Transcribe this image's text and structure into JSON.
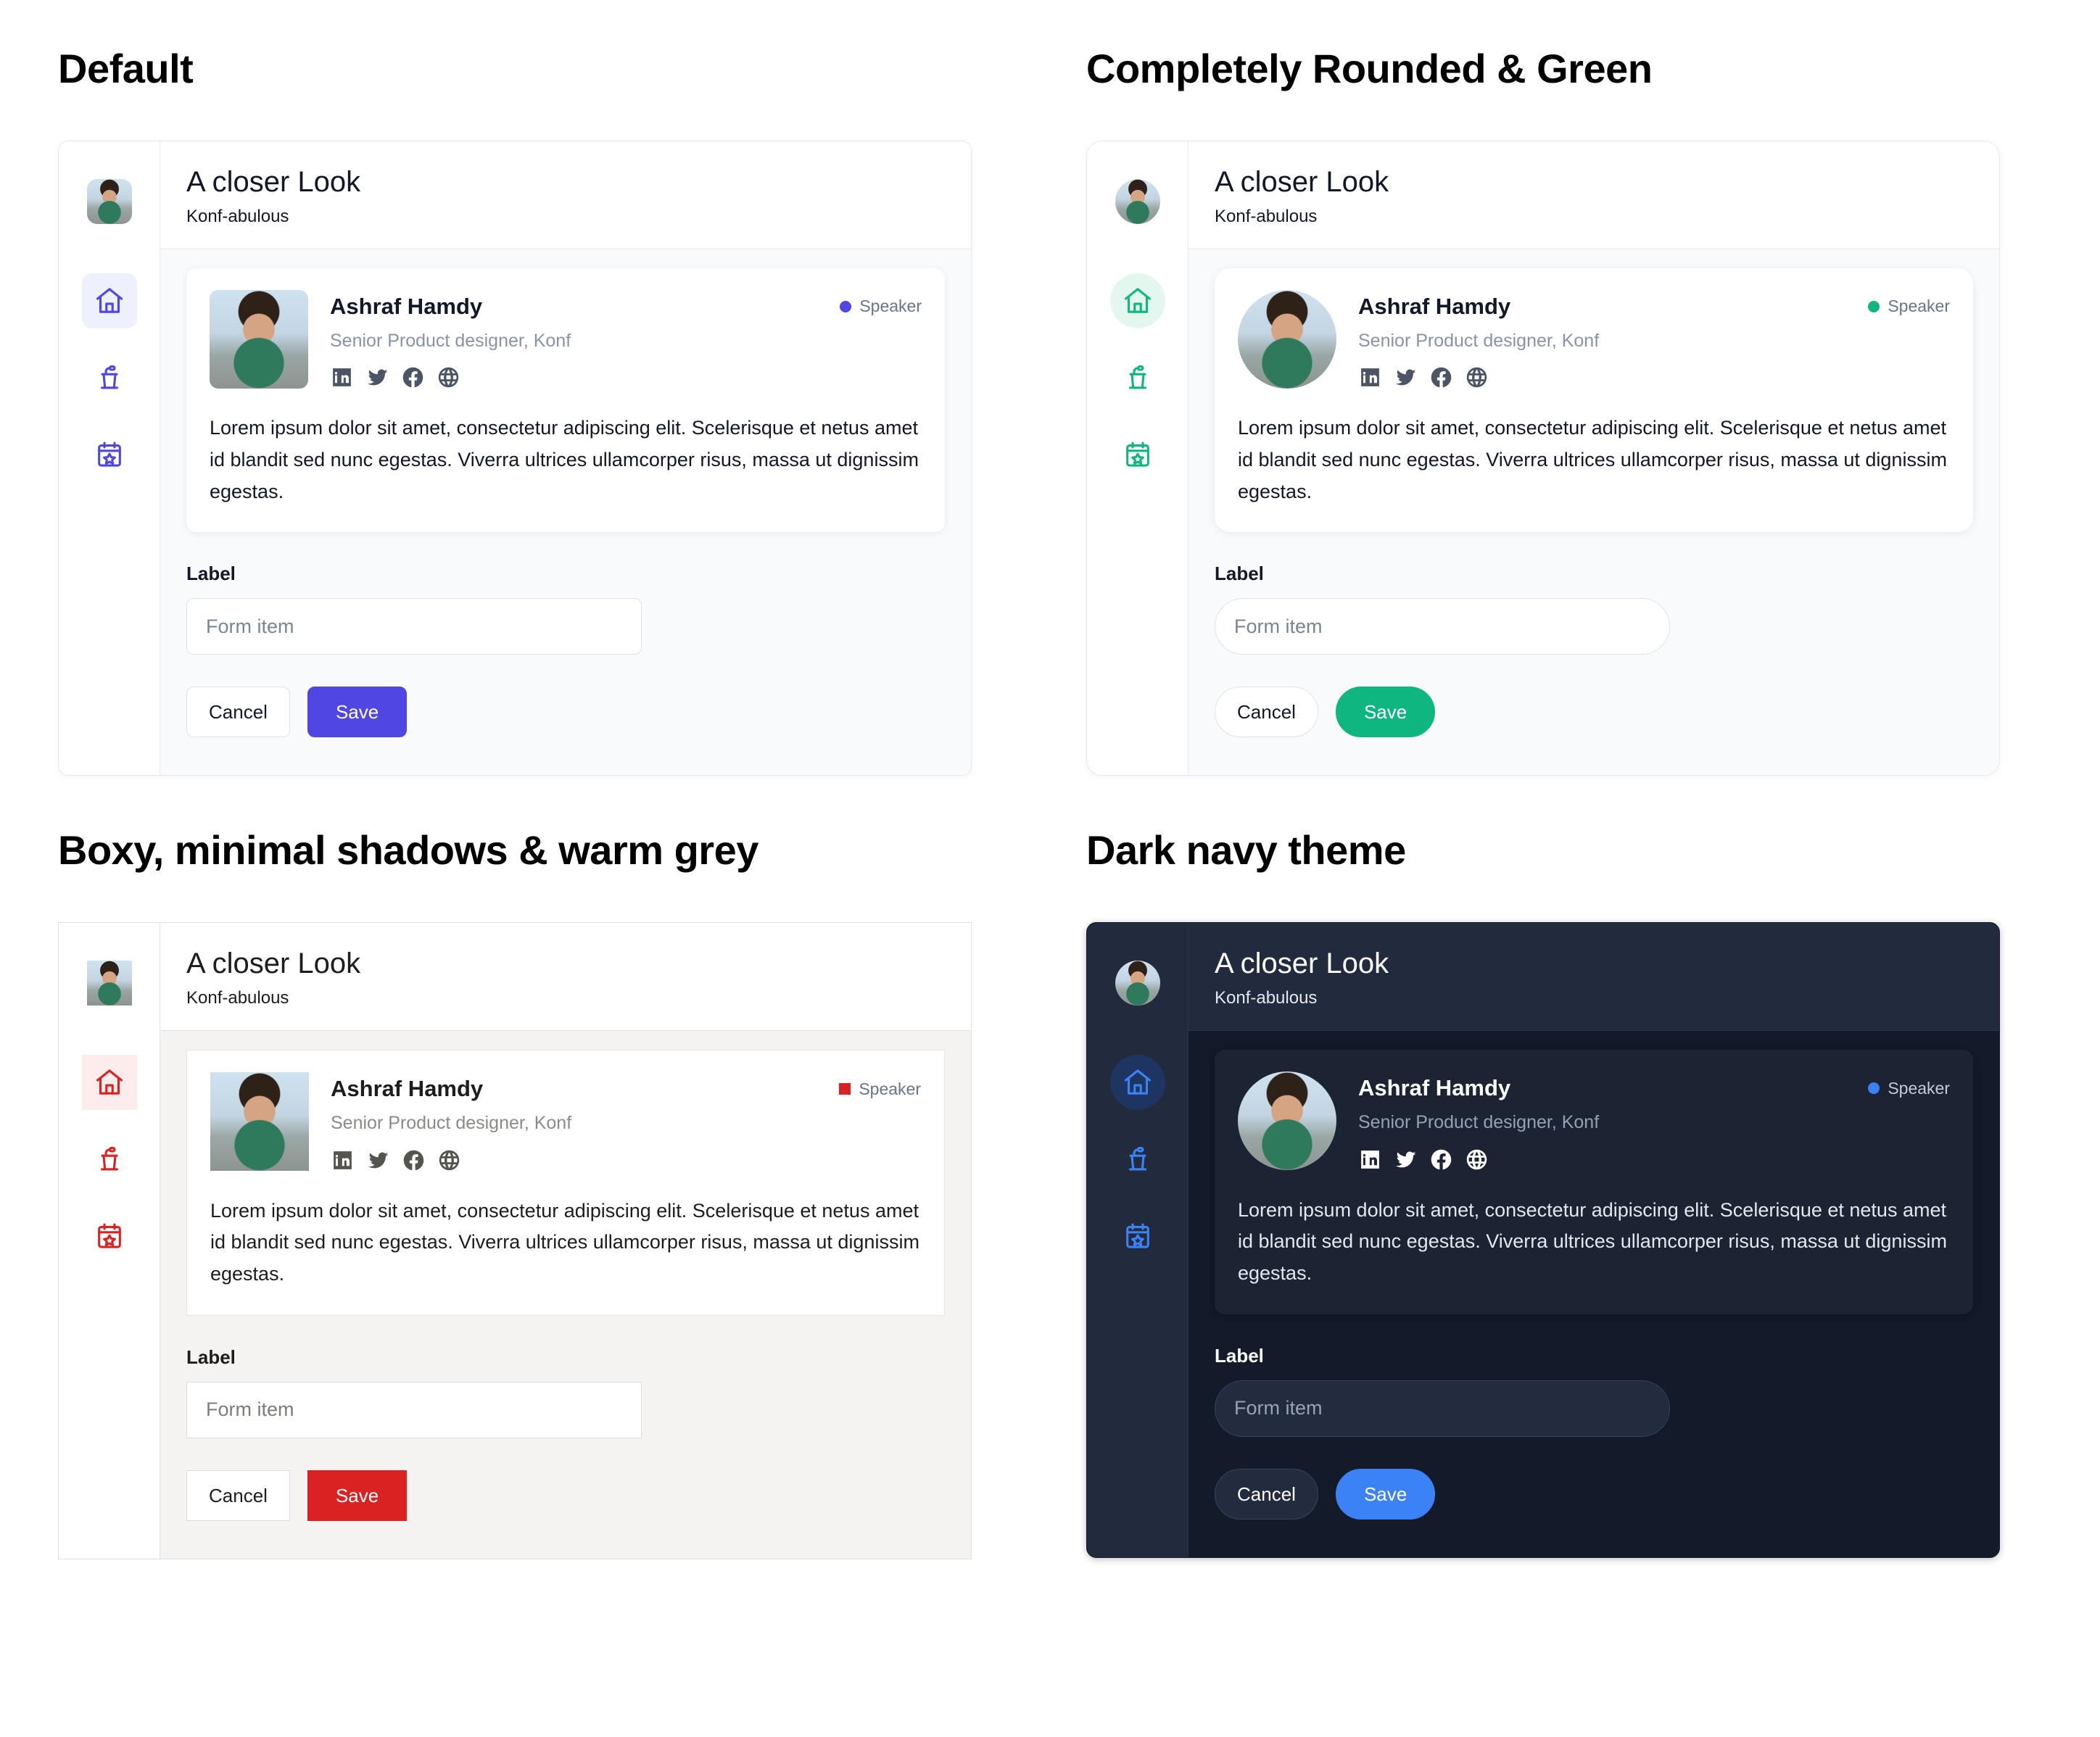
{
  "panels": [
    {
      "title": "Default",
      "theme": "t-default",
      "accent": "#5046e4",
      "accent_soft": "#eef0fe",
      "surface": "#ffffff",
      "content_bg": "#f8fafc"
    },
    {
      "title": "Completely Rounded & Green",
      "theme": "t-green",
      "accent": "#0fb67f",
      "accent_soft": "#e4f7ee",
      "surface": "#ffffff",
      "content_bg": "#f8fafc"
    },
    {
      "title": "Boxy, minimal shadows & warm grey",
      "theme": "t-boxy",
      "accent": "#db2222",
      "accent_soft": "#fdecec",
      "surface": "#ffffff",
      "content_bg": "#f4f3f1"
    },
    {
      "title": "Dark navy theme",
      "theme": "t-dark",
      "accent": "#3b82f6",
      "accent_soft": "#1d3560",
      "surface": "#1c2434",
      "content_bg": "#131a2a"
    }
  ],
  "app": {
    "title": "A closer Look",
    "subtitle": "Konf-abulous",
    "nav": [
      {
        "icon": "home-icon",
        "active": true
      },
      {
        "icon": "podium-icon",
        "active": false
      },
      {
        "icon": "calendar-star-icon",
        "active": false
      }
    ],
    "avatar_alt": "user-avatar"
  },
  "speaker": {
    "name": "Ashraf Hamdy",
    "role": "Senior Product designer, Konf",
    "badge_label": "Speaker",
    "bio": "Lorem ipsum dolor sit amet, consectetur adipiscing elit. Scelerisque et netus amet id blandit sed nunc egestas. Viverra ultrices ullamcorper risus, massa ut dignissim egestas.",
    "socials": [
      "linkedin-icon",
      "twitter-icon",
      "facebook-icon",
      "globe-icon"
    ],
    "photo_alt": "speaker-photo"
  },
  "form": {
    "label": "Label",
    "input_value": "",
    "input_placeholder": "Form item",
    "cancel_label": "Cancel",
    "save_label": "Save"
  }
}
